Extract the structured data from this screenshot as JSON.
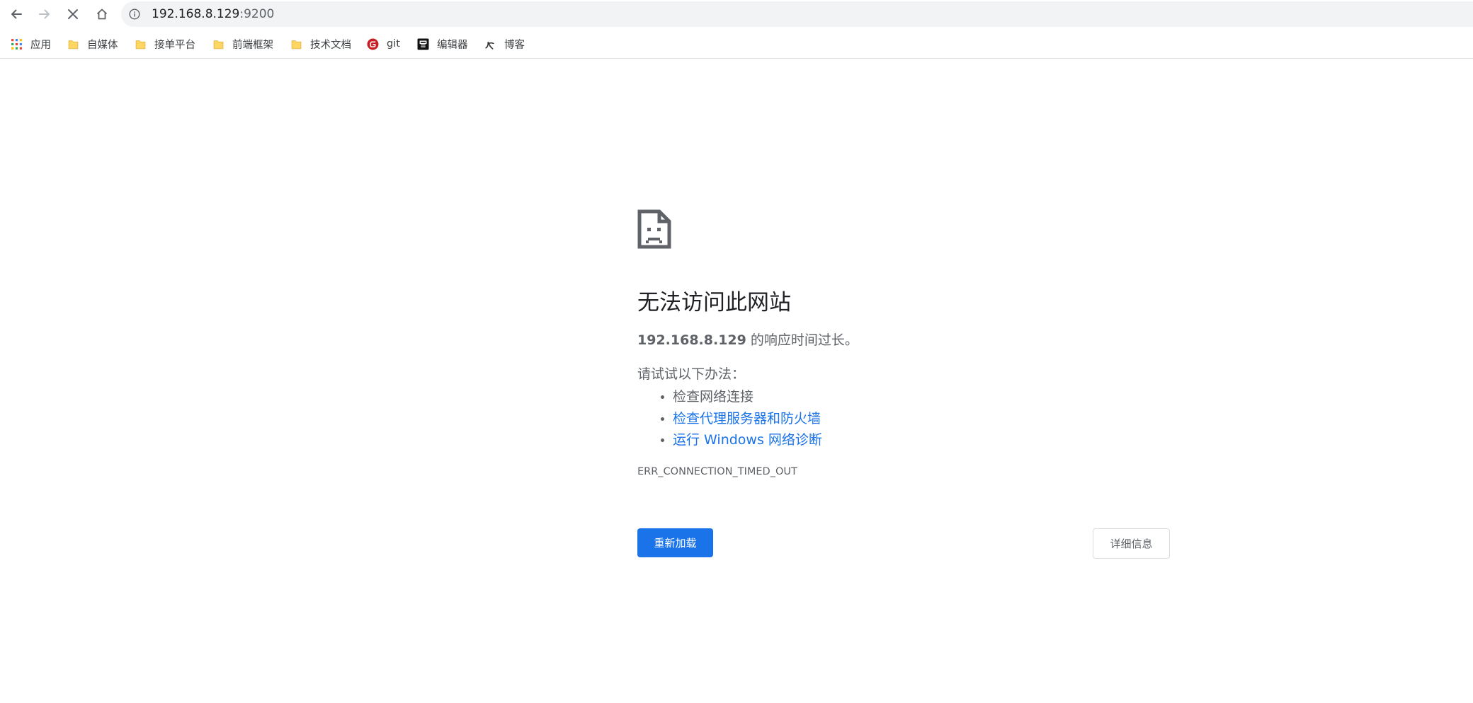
{
  "browser": {
    "address_bar": {
      "host": "192.168.8.129",
      "port": ":9200"
    },
    "bookmarks": [
      {
        "label": "应用",
        "icon": "apps-grid-icon"
      },
      {
        "label": "自媒体",
        "icon": "folder-icon"
      },
      {
        "label": "接单平台",
        "icon": "folder-icon"
      },
      {
        "label": "前端框架",
        "icon": "folder-icon"
      },
      {
        "label": "技术文档",
        "icon": "folder-icon"
      },
      {
        "label": "git",
        "icon": "gitee-icon"
      },
      {
        "label": "编辑器",
        "icon": "editor-icon"
      },
      {
        "label": "博客",
        "icon": "blog-icon"
      }
    ]
  },
  "error_page": {
    "icon": "sad-page-icon",
    "title": "无法访问此网站",
    "summary_host": "192.168.8.129",
    "summary_text": " 的响应时间过长。",
    "suggestions_heading": "请试试以下办法：",
    "suggestions": [
      {
        "text": "检查网络连接",
        "is_link": false
      },
      {
        "text": "检查代理服务器和防火墙",
        "is_link": true
      },
      {
        "text": "运行 Windows 网络诊断",
        "is_link": true
      }
    ],
    "error_code": "ERR_CONNECTION_TIMED_OUT",
    "reload_button": "重新加载",
    "details_button": "详细信息"
  },
  "colors": {
    "accent": "#1a73e8",
    "text_secondary": "#5f6368",
    "omnibox_bg": "#f1f3f4",
    "folder": "#fdd663"
  }
}
